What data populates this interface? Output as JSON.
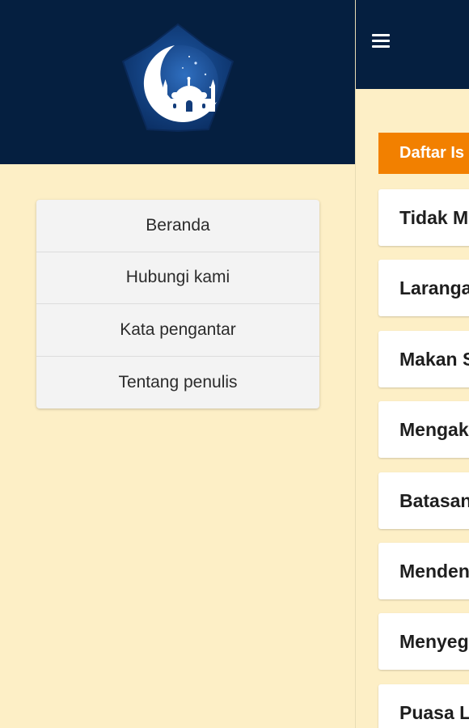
{
  "drawer": {
    "menu_items": [
      {
        "label": "Beranda"
      },
      {
        "label": "Hubungi kami"
      },
      {
        "label": "Kata pengantar"
      },
      {
        "label": "Tentang penulis"
      }
    ]
  },
  "main": {
    "section_title": "Daftar Is",
    "articles": [
      {
        "title": "Tidak M"
      },
      {
        "title": "Laranga"
      },
      {
        "title": "Makan S"
      },
      {
        "title": "Mengak"
      },
      {
        "title": "Batasan"
      },
      {
        "title": "Menden"
      },
      {
        "title": "Menyeg"
      },
      {
        "title": "Puasa L"
      }
    ]
  },
  "colors": {
    "header_bg": "#051f40",
    "page_bg": "#fdefc6",
    "accent": "#f28000"
  },
  "icons": {
    "menu": "hamburger-icon",
    "logo": "mosque-crescent-logo"
  }
}
